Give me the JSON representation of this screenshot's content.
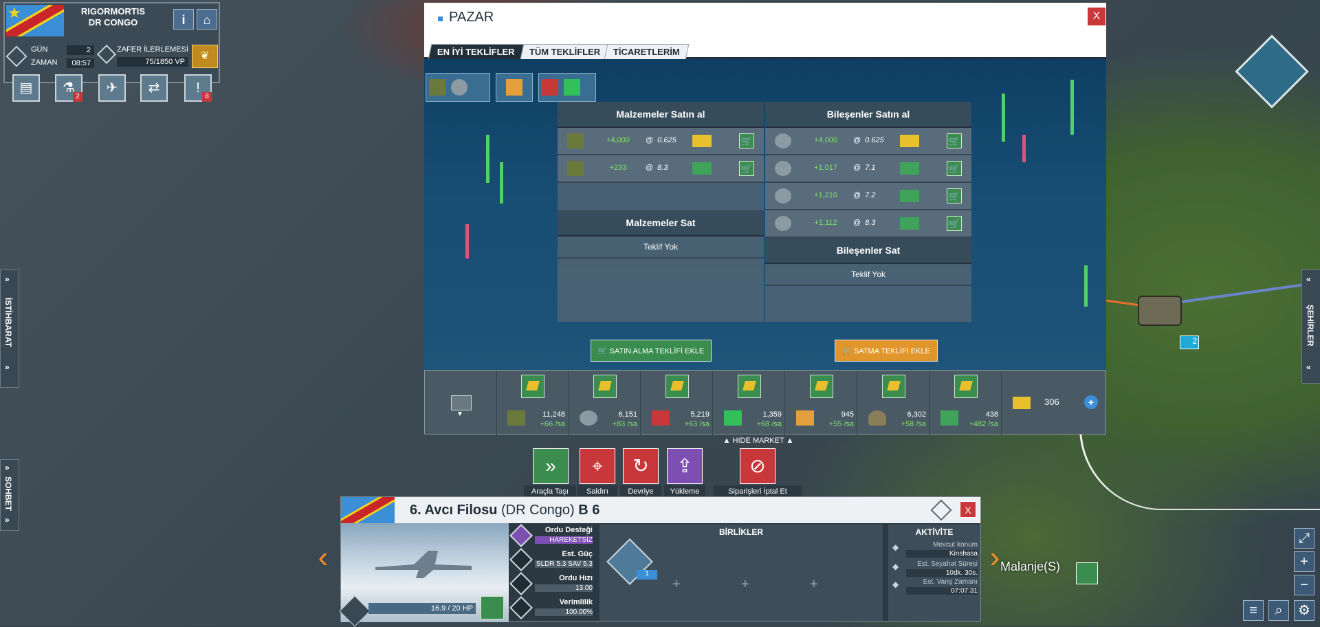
{
  "player": {
    "name_line1": "RIGORMORTIS",
    "name_line2": "DR CONGO"
  },
  "hud": {
    "day_label": "GÜN",
    "day_value": "2",
    "time_label": "ZAMAN",
    "time_value": "08:57",
    "victory_label": "ZAFER İLERLEMESİ",
    "victory_value": "75/1850 VP",
    "info_btn": "i"
  },
  "action_bar": [
    {
      "name": "newspaper",
      "badge": ""
    },
    {
      "name": "research",
      "badge": "2"
    },
    {
      "name": "diplomacy",
      "badge": ""
    },
    {
      "name": "trade",
      "badge": ""
    },
    {
      "name": "alerts",
      "badge": "8"
    }
  ],
  "side_tabs": {
    "left_intel": "İSTİHBARAT",
    "left_chat": "SOHBET",
    "right_cities": "ŞEHİRLER"
  },
  "market": {
    "title": "PAZAR",
    "close": "X",
    "tabs": [
      "EN İYİ TEKLİFLER",
      "TÜM TEKLİFLER",
      "TİCARETLERİM"
    ],
    "active_tab": 0,
    "materials_buy_header": "Malzemeler Satın al",
    "components_buy_header": "Bileşenler Satın al",
    "materials_sell_header": "Malzemeler Sat",
    "components_sell_header": "Bileşenler Sat",
    "no_offer": "Teklif Yok",
    "materials_buy": [
      {
        "qty": "+4,000",
        "at": "@",
        "price": "0.625",
        "currency": "gold"
      },
      {
        "qty": "+233",
        "at": "@",
        "price": "8.3",
        "currency": "money"
      }
    ],
    "components_buy": [
      {
        "qty": "+4,000",
        "at": "@",
        "price": "0.625",
        "currency": "gold"
      },
      {
        "qty": "+1,017",
        "at": "@",
        "price": "7.1",
        "currency": "money"
      },
      {
        "qty": "+1,210",
        "at": "@",
        "price": "7.2",
        "currency": "money"
      },
      {
        "qty": "+1,112",
        "at": "@",
        "price": "8.3",
        "currency": "money"
      }
    ],
    "buy_offer_btn": "SATIN ALMA TEKLİFİ EKLE",
    "sell_offer_btn": "SATMA TEKLİFİ EKLE",
    "hide_market": "HIDE MARKET",
    "resources": [
      {
        "name": "supplies",
        "amount": "11,248",
        "rate": "+66 /sa"
      },
      {
        "name": "components",
        "amount": "6,151",
        "rate": "+83 /sa"
      },
      {
        "name": "fuel",
        "amount": "5,219",
        "rate": "+63 /sa"
      },
      {
        "name": "electronics",
        "amount": "1,359",
        "rate": "+68 /sa"
      },
      {
        "name": "rare-materials",
        "amount": "945",
        "rate": "+55 /sa"
      },
      {
        "name": "manpower",
        "amount": "6,302",
        "rate": "+58 /sa"
      },
      {
        "name": "money",
        "amount": "438",
        "rate": "+482 /sa"
      }
    ],
    "gold": "306"
  },
  "commands": [
    {
      "label": "Araçla Taşı",
      "color": "#3b8d4f"
    },
    {
      "label": "Saldırı",
      "color": "#c8373a"
    },
    {
      "label": "Devriye",
      "color": "#c8373a"
    },
    {
      "label": "Yükleme",
      "color": "#7e4fb3"
    },
    {
      "label": "Siparişleri İptal Et",
      "color": "#c8373a"
    }
  ],
  "unit": {
    "name": "6. Avcı Filosu",
    "country": "(DR Congo)",
    "code": "B 6",
    "hp": "16.9 / 20 HP",
    "close": "X",
    "stats": [
      {
        "label": "Ordu Desteği",
        "value": "HAREKETSİZ"
      },
      {
        "label": "Est. Güç",
        "value": "SLDR 5.3 SAV 5.3"
      },
      {
        "label": "Ordu Hızı",
        "value": "13.00"
      },
      {
        "label": "Verimlilik",
        "value": "100.00%"
      }
    ],
    "troops_header": "BİRLİKLER",
    "troop_count": "1",
    "activity_header": "AKTİVİTE",
    "activity": [
      {
        "label": "Mevcut konum",
        "value": "Kinshasa"
      },
      {
        "label": "Est. Seyahat Süresi",
        "value": "10dk. 30s."
      },
      {
        "label": "Est. Varış Zamanı",
        "value": "07:07:31"
      }
    ]
  },
  "map": {
    "city_label": "Malanje(S)",
    "convoy_count": "2"
  }
}
